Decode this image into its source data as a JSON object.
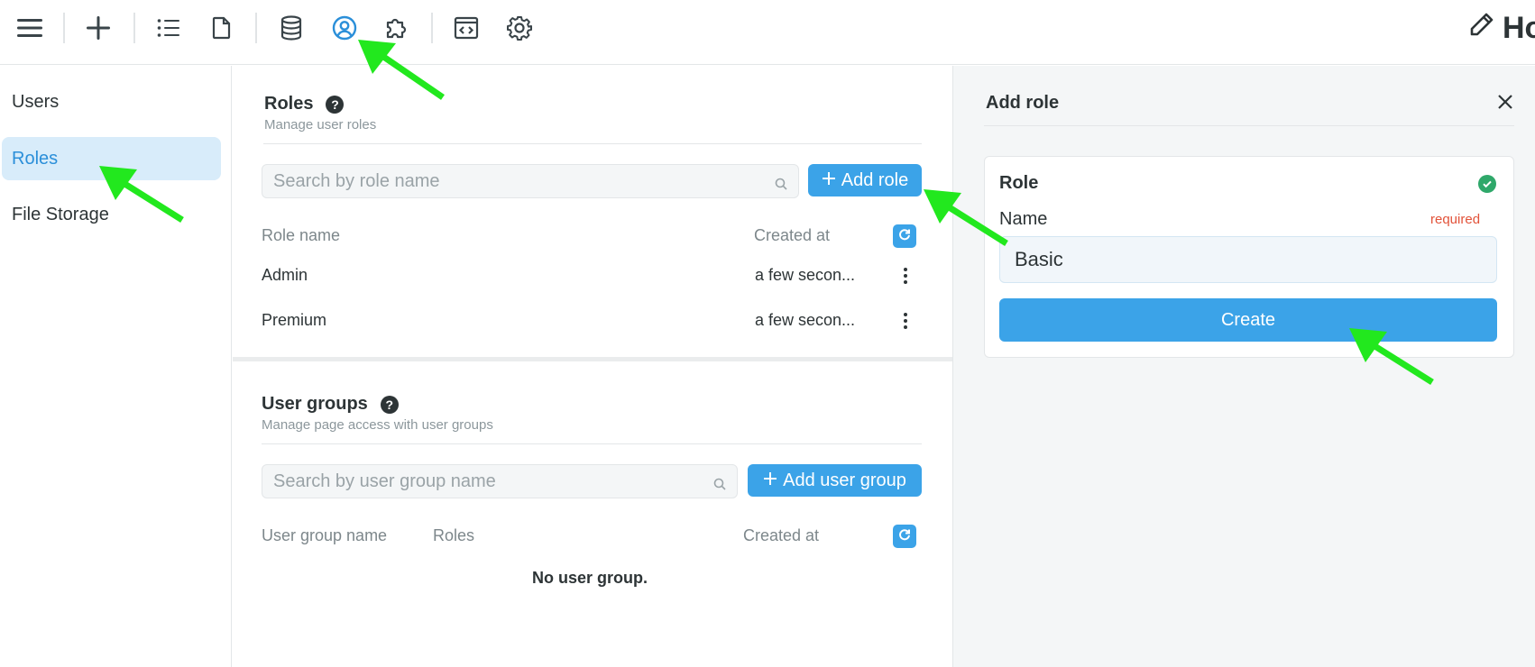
{
  "toolbar": {
    "icons": [
      "menu-icon",
      "plus-icon",
      "list-icon",
      "file-icon",
      "database-icon",
      "user-circle-icon",
      "puzzle-icon",
      "code-window-icon",
      "gear-icon"
    ],
    "title": "Ho",
    "active_color": "#2b8fd9"
  },
  "sidebar": {
    "items": [
      {
        "label": "Users"
      },
      {
        "label": "Roles",
        "active": true
      },
      {
        "label": "File Storage"
      }
    ]
  },
  "roles": {
    "title": "Roles",
    "help": "?",
    "subtitle": "Manage user roles",
    "search_placeholder": "Search by role name",
    "add_button": "Add role",
    "columns": {
      "name": "Role name",
      "created": "Created at"
    },
    "rows": [
      {
        "name": "Admin",
        "created": "a few secon..."
      },
      {
        "name": "Premium",
        "created": "a few secon..."
      }
    ]
  },
  "groups": {
    "title": "User groups",
    "help": "?",
    "subtitle": "Manage page access with user groups",
    "search_placeholder": "Search by user group name",
    "add_button": "Add user group",
    "columns": {
      "name": "User group name",
      "roles": "Roles",
      "created": "Created at"
    },
    "empty": "No user group."
  },
  "panel": {
    "title": "Add role",
    "card_title": "Role",
    "field_label": "Name",
    "required": "required",
    "field_value": "Basic",
    "submit": "Create"
  },
  "colors": {
    "accent": "#3ba3e8",
    "annotation_arrow": "#22e81e",
    "success": "#2fa86a",
    "required": "#e2533a"
  }
}
